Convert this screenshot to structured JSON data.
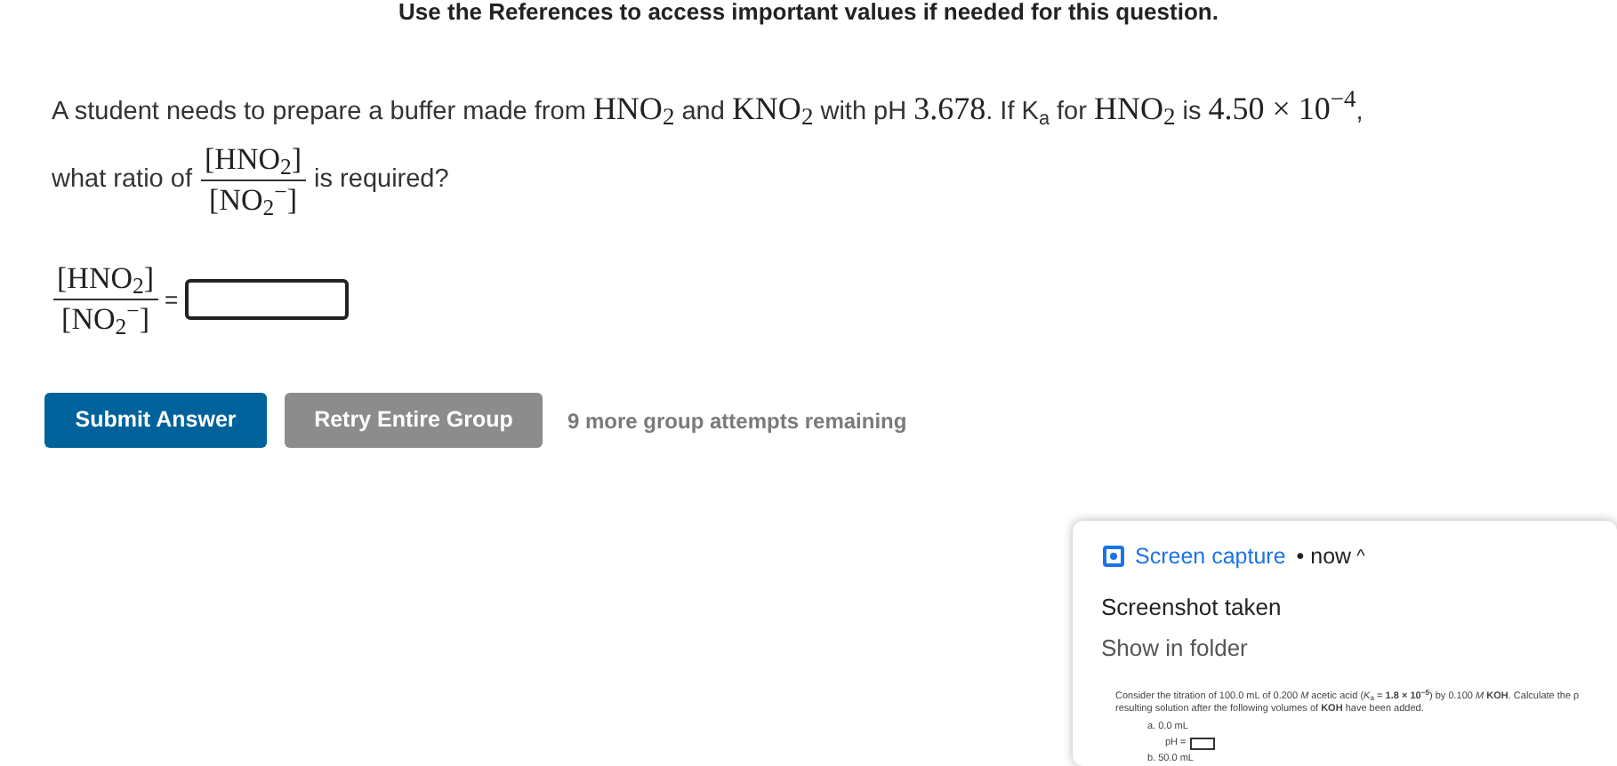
{
  "header_note": "Use the References to access important values if needed for this question.",
  "question": {
    "line_1": [
      {
        "kind": "text",
        "text": "A student needs to prepare a buffer made from "
      },
      {
        "kind": "math",
        "text": "HNO$_{2}$"
      },
      {
        "kind": "text",
        "text": " and "
      },
      {
        "kind": "math",
        "text": "KNO$_{2}$"
      },
      {
        "kind": "text",
        "text": " with pH "
      },
      {
        "kind": "math",
        "text": "3.678"
      },
      {
        "kind": "text",
        "text": ". If K$_{a}$ for "
      },
      {
        "kind": "math",
        "text": "HNO$_{2}$"
      },
      {
        "kind": "text",
        "text": " is "
      },
      {
        "kind": "math",
        "text": "4.50 × 10$^{−4}$"
      },
      {
        "kind": "text",
        "text": ","
      }
    ],
    "line_2_before": "what ratio of",
    "fraction": {
      "numerator": "[HNO$_{2}$]",
      "denominator": "[NO$_{2}$$^{−}$]"
    },
    "line_2_after": "is required?"
  },
  "answer": {
    "fraction": {
      "numerator": "[HNO$_{2}$]",
      "denominator": "[NO$_{2}$$^{−}$]"
    },
    "equals": "="
  },
  "buttons": [
    {
      "label": "Submit Answer",
      "kind": "primary"
    },
    {
      "label": "Retry Entire Group",
      "kind": "secondary"
    }
  ],
  "attempts": "9 more group attempts remaining",
  "notification": {
    "app": "Screen capture",
    "time": "• now",
    "caret": "^",
    "title": "Screenshot taken",
    "action": "Show in folder",
    "preview": {
      "lines": [
        "Consider the titration of 100.0 mL of 0.200 *M* acetic acid (*K*$_{a}$ = **1.8 × 10$^{−5}$**) by 0.100 *M* **KOH**. Calculate the p",
        "resulting solution after the following volumes of **KOH** have been added."
      ],
      "item_a": "a. 0.0 mL",
      "ph_label": "pH =",
      "item_b": "b. 50.0 mL"
    }
  }
}
